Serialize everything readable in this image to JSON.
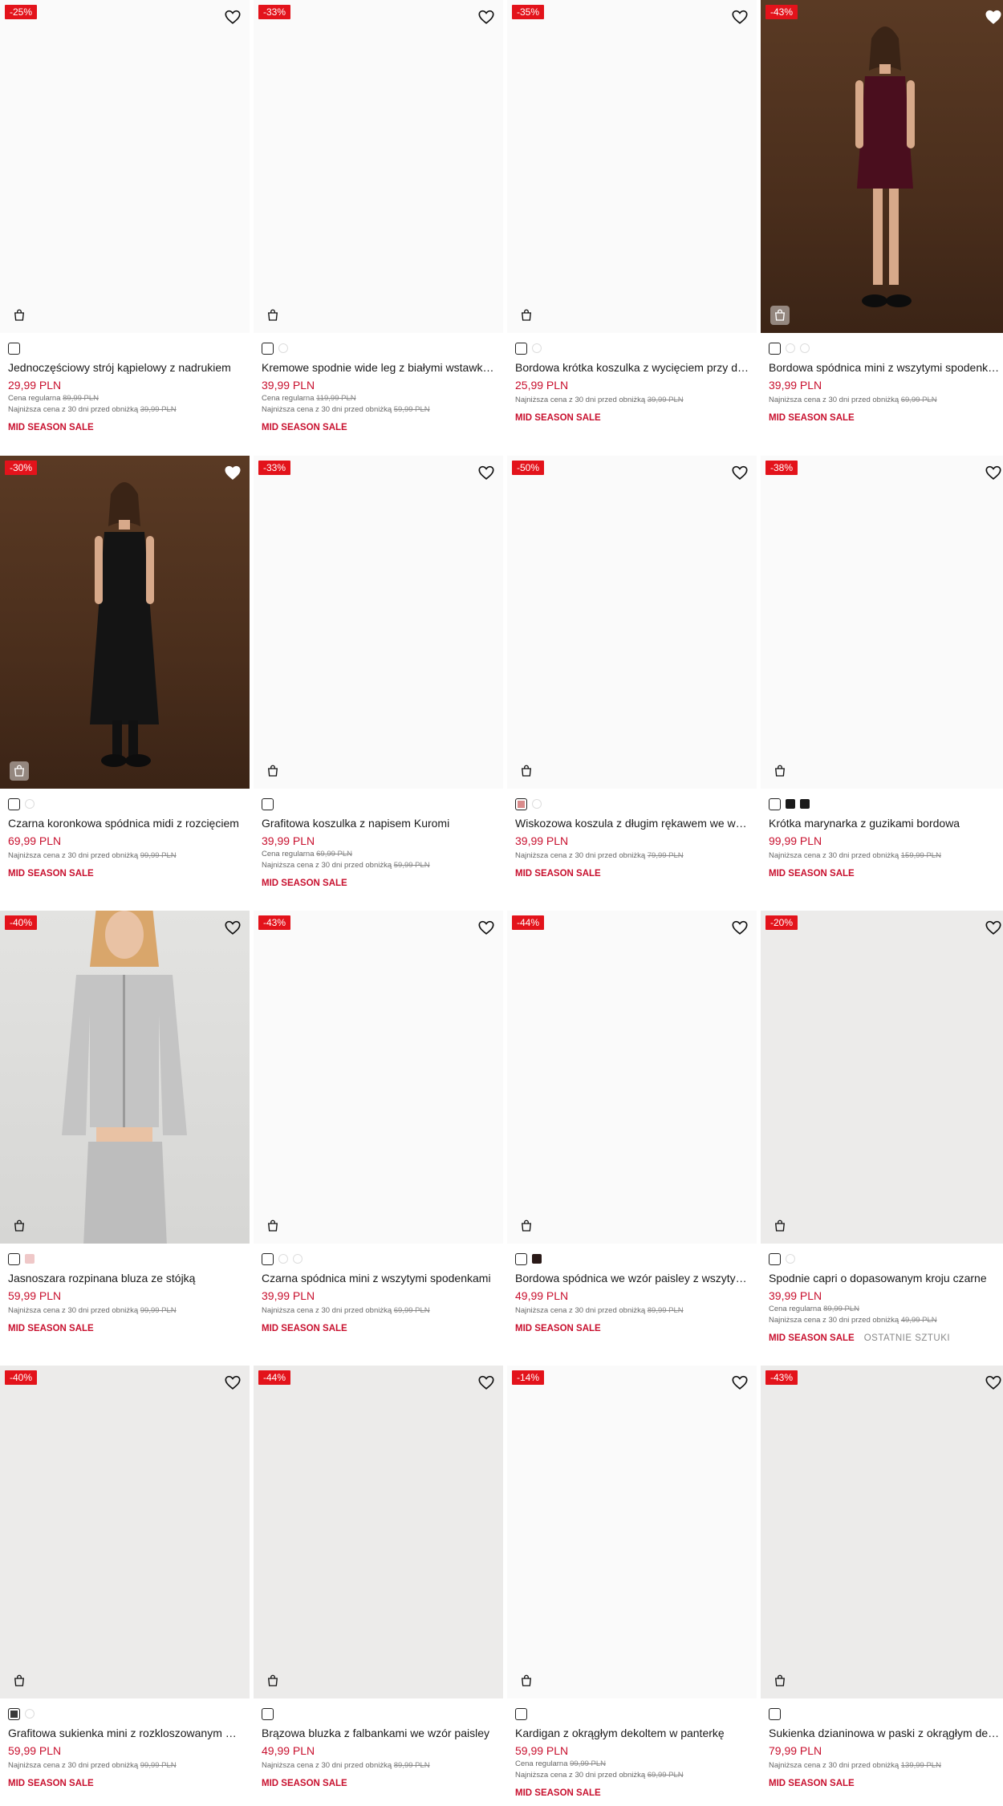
{
  "products": [
    {
      "badge": "-25%",
      "title": "Jednoczęściowy strój kąpielowy z nadrukiem",
      "price": "29,99 PLN",
      "regular_label": "Cena regularna",
      "regular_price": "89,99 PLN",
      "lowest_label": "Najniższa cena z 30 dni przed obniżką",
      "lowest_price": "39,99 PLN",
      "tag": "MID SEASON SALE",
      "photo": "none",
      "heart_filled": false
    },
    {
      "badge": "-33%",
      "title": "Kremowe spodnie wide leg z białymi wstawkami",
      "price": "39,99 PLN",
      "regular_label": "Cena regularna",
      "regular_price": "119,99 PLN",
      "lowest_label": "Najniższa cena z 30 dni przed obniżką",
      "lowest_price": "59,99 PLN",
      "tag": "MID SEASON SALE",
      "photo": "none",
      "heart_filled": false
    },
    {
      "badge": "-35%",
      "title": "Bordowa krótka koszulka z wycięciem przy dekolcie",
      "price": "25,99 PLN",
      "lowest_label": "Najniższa cena z 30 dni przed obniżką",
      "lowest_price": "39,99 PLN",
      "tag": "MID SEASON SALE",
      "photo": "none",
      "heart_filled": false
    },
    {
      "badge": "-43%",
      "title": "Bordowa spódnica mini z wszytymi spodenkami",
      "price": "39,99 PLN",
      "lowest_label": "Najniższa cena z 30 dni przed obniżką",
      "lowest_price": "69,99 PLN",
      "tag": "MID SEASON SALE",
      "photo": "brown",
      "heart_filled": true
    },
    {
      "badge": "-30%",
      "title": "Czarna koronkowa spódnica midi z rozcięciem",
      "price": "69,99 PLN",
      "lowest_label": "Najniższa cena z 30 dni przed obniżką",
      "lowest_price": "99,99 PLN",
      "tag": "MID SEASON SALE",
      "photo": "brown2",
      "heart_filled": true
    },
    {
      "badge": "-33%",
      "title": "Grafitowa koszulka z napisem Kuromi",
      "price": "39,99 PLN",
      "regular_label": "Cena regularna",
      "regular_price": "69,99 PLN",
      "lowest_label": "Najniższa cena z 30 dni przed obniżką",
      "lowest_price": "59,99 PLN",
      "tag": "MID SEASON SALE",
      "photo": "none",
      "heart_filled": false
    },
    {
      "badge": "-50%",
      "title": "Wiskozowa koszula z długim rękawem we wzór",
      "price": "39,99 PLN",
      "lowest_label": "Najniższa cena z 30 dni przed obniżką",
      "lowest_price": "79,99 PLN",
      "tag": "MID SEASON SALE",
      "photo": "none",
      "heart_filled": false
    },
    {
      "badge": "-38%",
      "title": "Krótka marynarka z guzikami bordowa",
      "price": "99,99 PLN",
      "lowest_label": "Najniższa cena z 30 dni przed obniżką",
      "lowest_price": "159,99 PLN",
      "tag": "MID SEASON SALE",
      "photo": "none",
      "heart_filled": false
    },
    {
      "badge": "-40%",
      "title": "Jasnoszara rozpinana bluza ze stójką",
      "price": "59,99 PLN",
      "lowest_label": "Najniższa cena z 30 dni przed obniżką",
      "lowest_price": "99,99 PLN",
      "tag": "MID SEASON SALE",
      "photo": "grey",
      "heart_filled": false
    },
    {
      "badge": "-43%",
      "title": "Czarna spódnica mini z wszytymi spodenkami",
      "price": "39,99 PLN",
      "lowest_label": "Najniższa cena z 30 dni przed obniżką",
      "lowest_price": "69,99 PLN",
      "tag": "MID SEASON SALE",
      "photo": "none",
      "heart_filled": false
    },
    {
      "badge": "-44%",
      "title": "Bordowa spódnica we wzór paisley z wszytymi spodenkami",
      "price": "49,99 PLN",
      "lowest_label": "Najniższa cena z 30 dni przed obniżką",
      "lowest_price": "89,99 PLN",
      "tag": "MID SEASON SALE",
      "photo": "none",
      "heart_filled": false
    },
    {
      "badge": "-20%",
      "title": "Spodnie capri o dopasowanym kroju czarne",
      "price": "39,99 PLN",
      "regular_label": "Cena regularna",
      "regular_price": "89,99 PLN",
      "lowest_label": "Najniższa cena z 30 dni przed obniżką",
      "lowest_price": "49,99 PLN",
      "tag": "MID SEASON SALE",
      "tag2": "OSTATNIE SZTUKI",
      "photo": "light",
      "heart_filled": false
    },
    {
      "badge": "-40%",
      "title": "Grafitowa sukienka mini z rozkloszowanym dołem",
      "price": "59,99 PLN",
      "lowest_label": "Najniższa cena z 30 dni przed obniżką",
      "lowest_price": "99,99 PLN",
      "tag": "MID SEASON SALE",
      "photo": "light",
      "heart_filled": false
    },
    {
      "badge": "-44%",
      "title": "Brązowa bluzka z falbankami we wzór paisley",
      "price": "49,99 PLN",
      "lowest_label": "Najniższa cena z 30 dni przed obniżką",
      "lowest_price": "89,99 PLN",
      "tag": "MID SEASON SALE",
      "photo": "light",
      "heart_filled": false
    },
    {
      "badge": "-14%",
      "title": "Kardigan z okrągłym dekoltem w panterkę",
      "price": "59,99 PLN",
      "regular_label": "Cena regularna",
      "regular_price": "99,99 PLN",
      "lowest_label": "Najniższa cena z 30 dni przed obniżką",
      "lowest_price": "69,99 PLN",
      "tag": "MID SEASON SALE",
      "photo": "none",
      "heart_filled": false
    },
    {
      "badge": "-43%",
      "title": "Sukienka dzianinowa w paski z okrągłym dekoltem",
      "price": "79,99 PLN",
      "lowest_label": "Najniższa cena z 30 dni przed obniżką",
      "lowest_price": "139,99 PLN",
      "tag": "MID SEASON SALE",
      "photo": "light",
      "heart_filled": false
    }
  ],
  "colors": {
    "badge": "#e3131b",
    "price": "#c8102e",
    "sale_tag": "#c8102e"
  },
  "icons": {
    "wishlist": "heart-icon",
    "add_to_cart": "shopping-bag-icon"
  }
}
